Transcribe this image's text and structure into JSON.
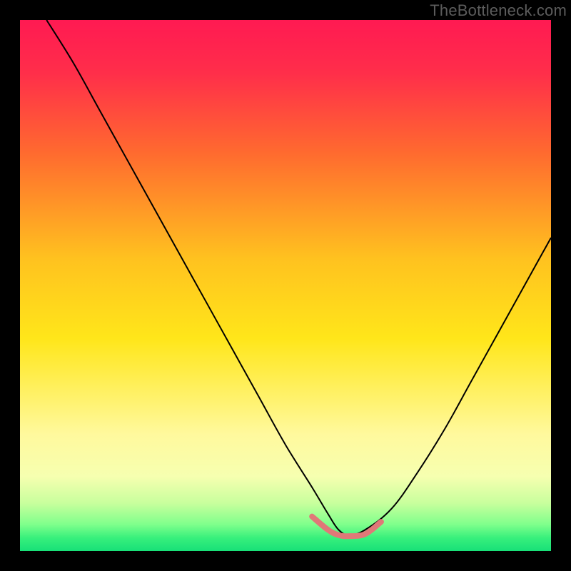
{
  "watermark": "TheBottleneck.com",
  "chart_data": {
    "type": "line",
    "title": "",
    "xlabel": "",
    "ylabel": "",
    "xlim": [
      0,
      100
    ],
    "ylim": [
      0,
      100
    ],
    "grid": false,
    "legend": false,
    "gradient_stops": [
      {
        "offset": 0.0,
        "color": "#ff1a52"
      },
      {
        "offset": 0.1,
        "color": "#ff2e4a"
      },
      {
        "offset": 0.25,
        "color": "#ff6a2f"
      },
      {
        "offset": 0.45,
        "color": "#ffc21f"
      },
      {
        "offset": 0.6,
        "color": "#ffe61a"
      },
      {
        "offset": 0.78,
        "color": "#fff99d"
      },
      {
        "offset": 0.86,
        "color": "#f6ffb0"
      },
      {
        "offset": 0.91,
        "color": "#c8ff9d"
      },
      {
        "offset": 0.95,
        "color": "#7fff8c"
      },
      {
        "offset": 0.975,
        "color": "#38f07c"
      },
      {
        "offset": 1.0,
        "color": "#18e078"
      }
    ],
    "series": [
      {
        "name": "bottleneck-curve",
        "x": [
          5,
          10,
          15,
          20,
          25,
          30,
          35,
          40,
          45,
          50,
          55,
          58,
          60,
          62,
          65,
          70,
          75,
          80,
          85,
          90,
          95,
          100
        ],
        "y": [
          100,
          92,
          83,
          74,
          65,
          56,
          47,
          38,
          29,
          20,
          12,
          7,
          4,
          3,
          4,
          8,
          15,
          23,
          32,
          41,
          50,
          59
        ],
        "color": "#000000",
        "width": 2
      }
    ],
    "highlight": {
      "name": "sweet-spot",
      "color": "#e07878",
      "width": 8,
      "x": [
        55,
        58,
        60,
        62,
        65,
        68
      ],
      "y": [
        6.5,
        4,
        3,
        2.8,
        3.2,
        5.5
      ]
    }
  }
}
